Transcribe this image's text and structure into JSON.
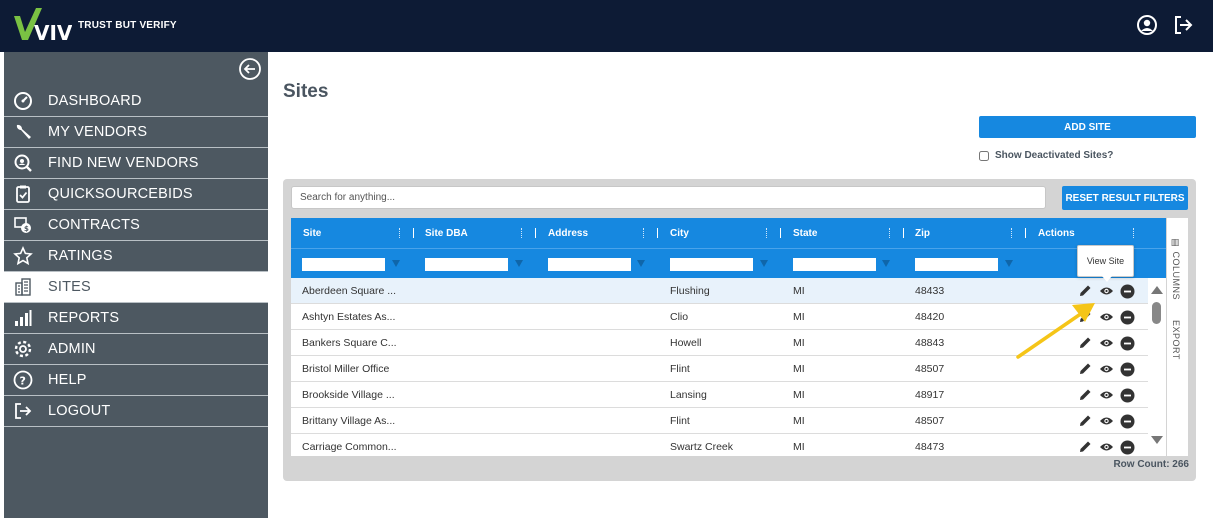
{
  "app": {
    "logo_text": "VIVE",
    "tagline": "TRUST BUT VERIFY",
    "top_icons": [
      "account-icon",
      "sign-out-icon"
    ]
  },
  "sidebar": {
    "items": [
      {
        "label": "DASHBOARD",
        "icon": "dashboard-gauge-icon",
        "active": false
      },
      {
        "label": "MY VENDORS",
        "icon": "wrench-icon",
        "active": false
      },
      {
        "label": "FIND NEW VENDORS",
        "icon": "search-vendor-icon",
        "active": false
      },
      {
        "label": "QUICKSOURCEBIDS",
        "icon": "clipboard-check-icon",
        "active": false
      },
      {
        "label": "CONTRACTS",
        "icon": "contract-money-icon",
        "active": false
      },
      {
        "label": "RATINGS",
        "icon": "star-icon",
        "active": false
      },
      {
        "label": "SITES",
        "icon": "building-icon",
        "active": true
      },
      {
        "label": "REPORTS",
        "icon": "bar-chart-icon",
        "active": false
      },
      {
        "label": "ADMIN",
        "icon": "gear-icon",
        "active": false
      },
      {
        "label": "HELP",
        "icon": "help-icon",
        "active": false
      },
      {
        "label": "LOGOUT",
        "icon": "logout-icon",
        "active": false
      }
    ]
  },
  "main": {
    "title": "Sites",
    "add_site_label": "ADD SITE",
    "show_deactivated_label": "Show Deactivated Sites?",
    "search_placeholder": "Search for anything...",
    "reset_label": "RESET RESULT FILTERS",
    "columns": [
      "Site",
      "Site DBA",
      "Address",
      "City",
      "State",
      "Zip",
      "Actions"
    ],
    "rows": [
      {
        "site": "Aberdeen Square ...",
        "dba": "",
        "address": "",
        "city": "Flushing",
        "state": "MI",
        "zip": "48433"
      },
      {
        "site": "Ashtyn Estates As...",
        "dba": "",
        "address": "",
        "city": "Clio",
        "state": "MI",
        "zip": "48420"
      },
      {
        "site": "Bankers Square C...",
        "dba": "",
        "address": "",
        "city": "Howell",
        "state": "MI",
        "zip": "48843"
      },
      {
        "site": "Bristol Miller Office",
        "dba": "",
        "address": "",
        "city": "Flint",
        "state": "MI",
        "zip": "48507"
      },
      {
        "site": "Brookside Village ...",
        "dba": "",
        "address": "",
        "city": "Lansing",
        "state": "MI",
        "zip": "48917"
      },
      {
        "site": "Brittany Village As...",
        "dba": "",
        "address": "",
        "city": "Flint",
        "state": "MI",
        "zip": "48507"
      },
      {
        "site": "Carriage Common...",
        "dba": "",
        "address": "",
        "city": "Swartz Creek",
        "state": "MI",
        "zip": "48473"
      }
    ],
    "row_actions": [
      "pencil-edit-icon",
      "eye-view-icon",
      "minus-circle-icon"
    ],
    "tooltip": "View Site",
    "side_tabs": [
      "COLUMNS",
      "EXPORT"
    ],
    "row_count_label": "Row Count: 266",
    "accent_color": "#1688e0",
    "annotation_arrow_color": "#f5c518"
  }
}
